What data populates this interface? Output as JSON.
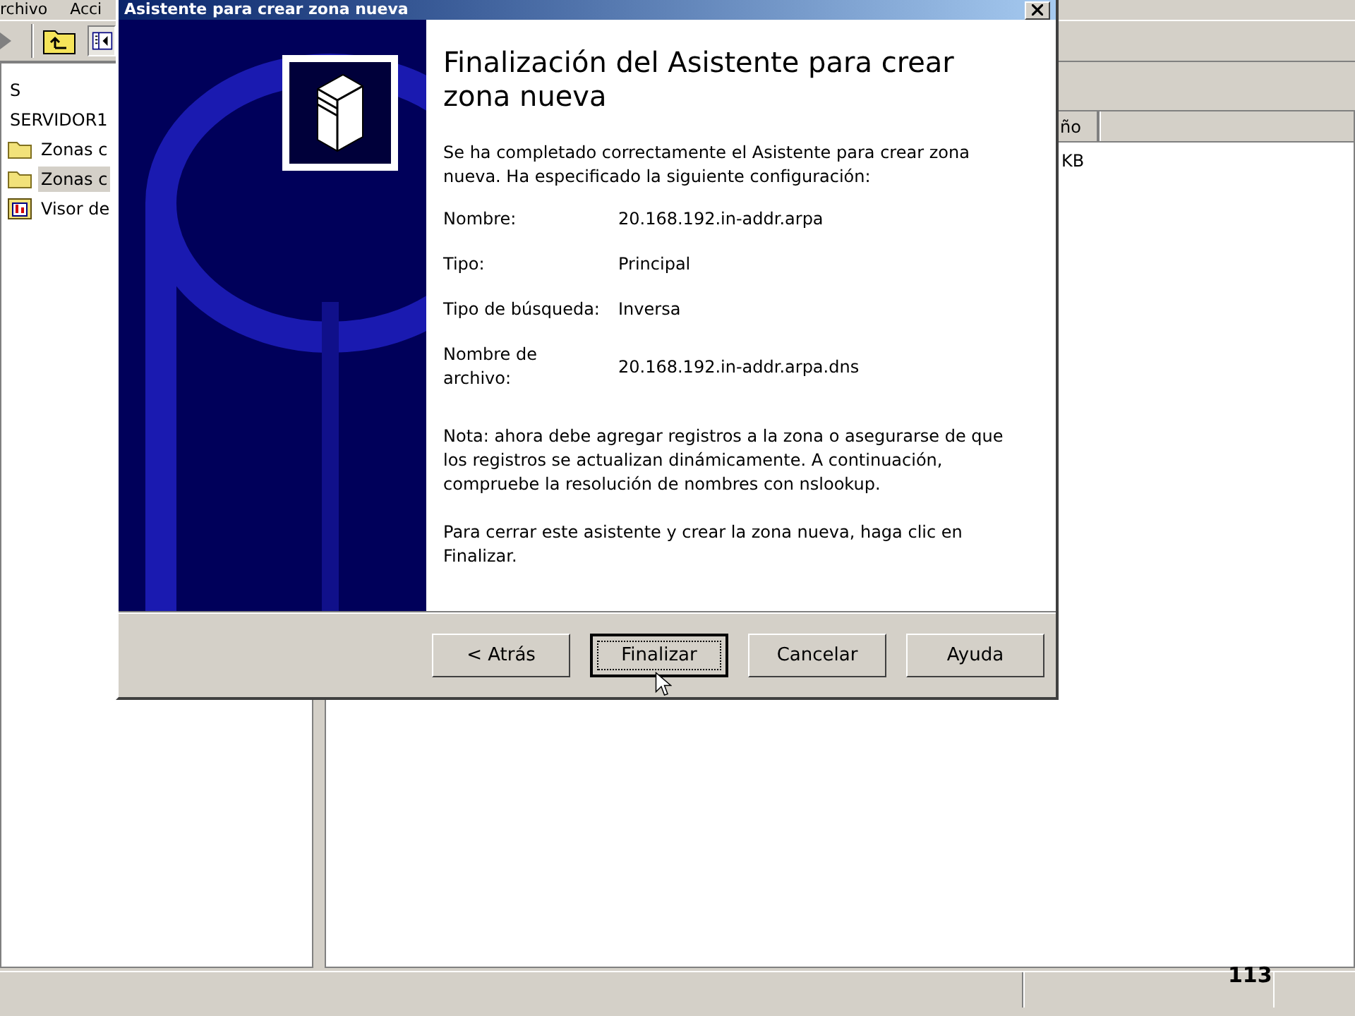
{
  "console": {
    "menu": [
      "rchivo",
      "Acci"
    ],
    "tree": [
      {
        "label": "S",
        "kind": "plain",
        "selected": false
      },
      {
        "label": "SERVIDOR1",
        "kind": "plain",
        "selected": false
      },
      {
        "label": "Zonas c",
        "kind": "folder",
        "selected": false
      },
      {
        "label": "Zonas c",
        "kind": "folder",
        "selected": true
      },
      {
        "label": "Visor de",
        "kind": "log",
        "selected": false
      }
    ],
    "list": {
      "columns": [
        "ño"
      ],
      "rows": [
        [
          "KB"
        ]
      ]
    }
  },
  "dialog": {
    "title": "Asistente para crear zona nueva",
    "heading": "Finalización del Asistente para crear zona nueva",
    "intro": "Se ha completado correctamente el Asistente para crear zona nueva. Ha especificado la siguiente configuración:",
    "settings": [
      {
        "label": "Nombre:",
        "value": "20.168.192.in-addr.arpa"
      },
      {
        "label": "Tipo:",
        "value": "Principal"
      },
      {
        "label": "Tipo de búsqueda:",
        "value": "Inversa"
      },
      {
        "label": "Nombre de archivo:",
        "value": "20.168.192.in-addr.arpa.dns"
      }
    ],
    "note": "Nota: ahora debe agregar registros a la zona o asegurarse de que los registros se actualizan dinámicamente. A continuación, compruebe la resolución de nombres con nslookup.",
    "closing": "Para cerrar este asistente y crear la zona nueva, haga clic en Finalizar.",
    "buttons": [
      {
        "label": "< Atrás",
        "default": false
      },
      {
        "label": "Finalizar",
        "default": true
      },
      {
        "label": "Cancelar",
        "default": false
      },
      {
        "label": "Ayuda",
        "default": false
      }
    ]
  },
  "page_number": "113"
}
